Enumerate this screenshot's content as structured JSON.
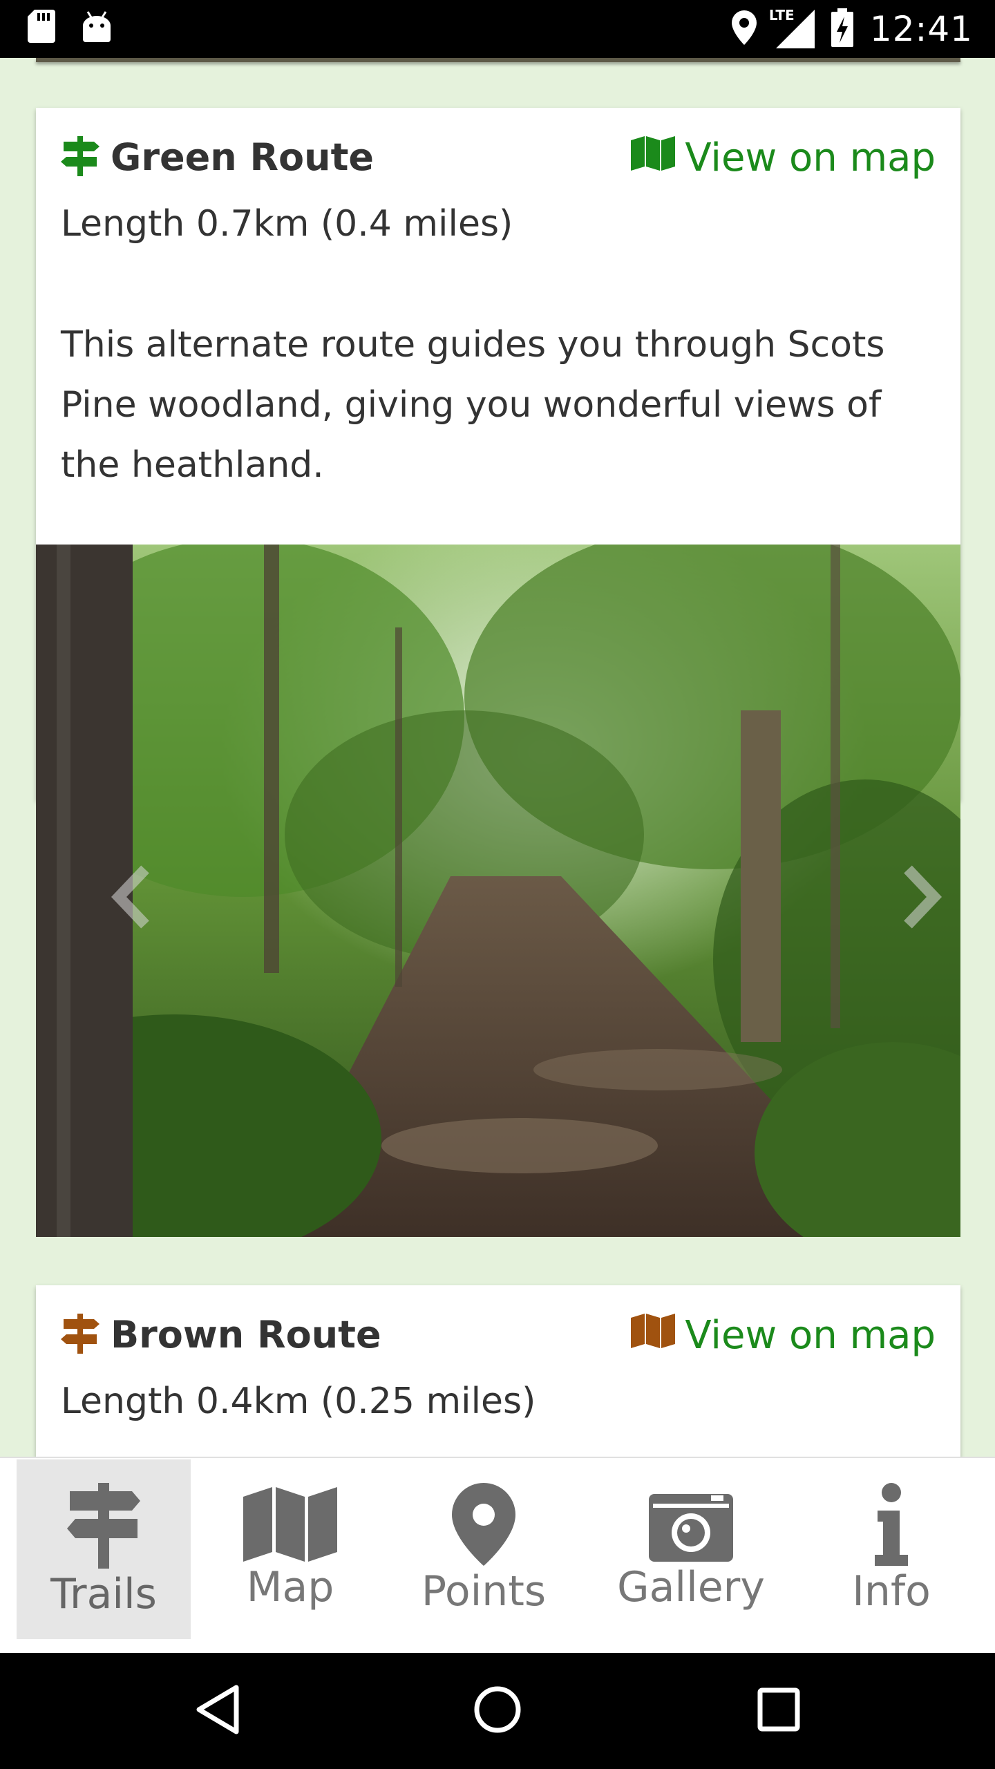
{
  "status_bar": {
    "time": "12:41",
    "network": "LTE",
    "icons": [
      "sd-card-icon",
      "android-icon",
      "location-icon",
      "signal-icon",
      "battery-charging-icon"
    ]
  },
  "routes": [
    {
      "name": "Green Route",
      "color": "#1b8a1b",
      "map_link": "View on map",
      "length": "Length 0.7km (0.4 miles)",
      "description": "This alternate route guides you through Scots Pine woodland, giving you wonderful views of the heathland."
    },
    {
      "name": "Brown Route",
      "color": "#a0520f",
      "map_link": "View on map",
      "length": "Length 0.4km (0.25 miles)"
    }
  ],
  "bottom_nav": {
    "active": "Trails",
    "items": [
      {
        "label": "Trails",
        "icon": "signpost-icon"
      },
      {
        "label": "Map",
        "icon": "map-icon"
      },
      {
        "label": "Points",
        "icon": "map-pin-icon"
      },
      {
        "label": "Gallery",
        "icon": "camera-icon"
      },
      {
        "label": "Info",
        "icon": "info-icon"
      }
    ]
  },
  "colors": {
    "background": "#e5f2dc",
    "link": "#1b8a1b",
    "text": "#333333",
    "nav_text": "#777777"
  }
}
